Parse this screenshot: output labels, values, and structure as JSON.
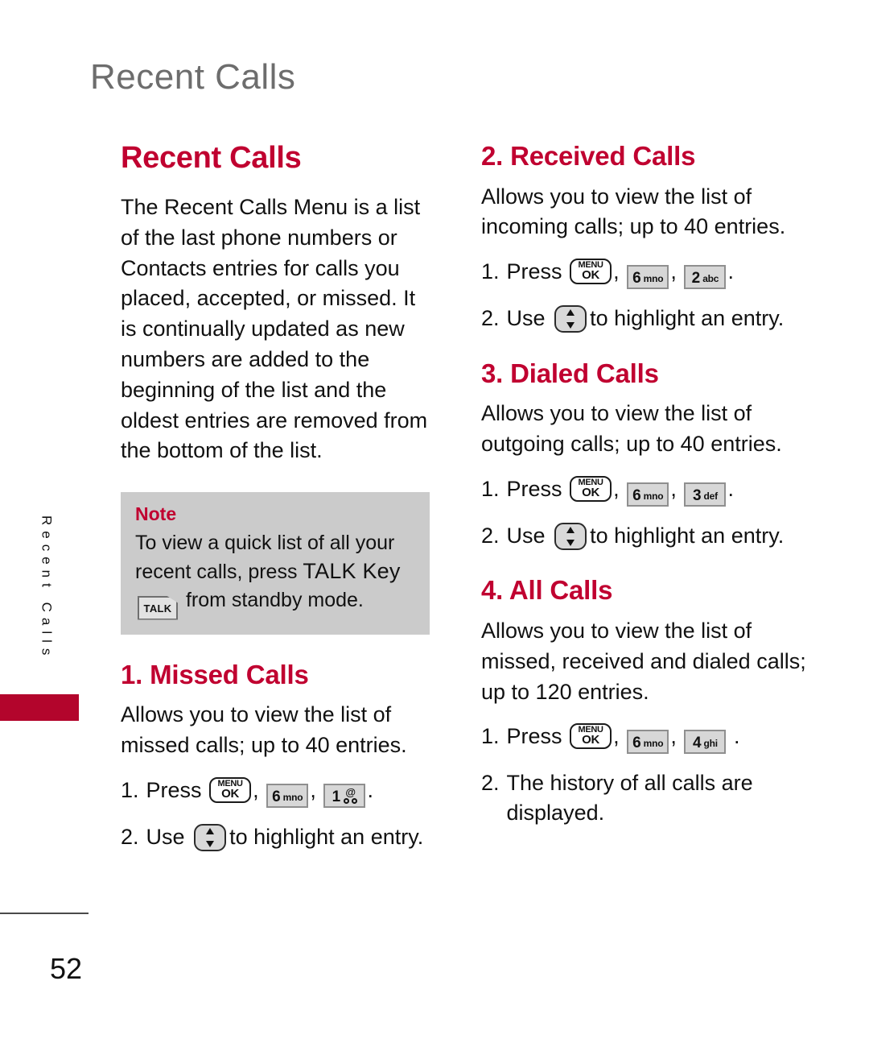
{
  "page": {
    "running_header": "Recent Calls",
    "number": "52"
  },
  "side_tab": {
    "label": "Recent Calls",
    "color": "#b3052c"
  },
  "colors": {
    "accent_red": "#c00030",
    "tab_red": "#b3052c",
    "header_gray": "#6d6d6d",
    "note_background": "#cbcbcb",
    "body_text": "#111111"
  },
  "keys": {
    "menu_ok": {
      "top": "MENU",
      "bottom": "OK",
      "name": "menu-ok-key"
    },
    "six": {
      "digit": "6",
      "letters": "mno",
      "name": "six-mno-key"
    },
    "one": {
      "digit": "1",
      "letters": "@",
      "name": "one-voicemail-key"
    },
    "two": {
      "digit": "2",
      "letters": "abc",
      "name": "two-abc-key"
    },
    "three": {
      "digit": "3",
      "letters": "def",
      "name": "three-def-key"
    },
    "four": {
      "digit": "4",
      "letters": "ghi",
      "name": "four-ghi-key"
    },
    "nav": {
      "name": "navigation-up-down-key"
    },
    "talk": {
      "label": "TALK",
      "name": "talk-key"
    }
  },
  "left_column": {
    "title": "Recent Calls",
    "intro": "The Recent Calls Menu is a list of the last phone numbers or Contacts entries for calls you placed, accepted, or missed. It is continually updated as new numbers are added to the beginning of the list and the oldest entries are removed from the bottom of the list.",
    "note": {
      "title": "Note",
      "text_before": "To view a quick list of all your recent calls, press ",
      "text_emphasis": "TALK Key",
      "text_after": " from standby mode."
    },
    "section_missed": {
      "title": "1. Missed Calls",
      "description": "Allows you to view the list of missed calls; up to 40 entries.",
      "step1_num": "1.",
      "step1_before": "Press ",
      "step1_comma1": ",",
      "step1_comma2": ",",
      "step1_period": ".",
      "step2_num": "2.",
      "step2_before": "Use ",
      "step2_after": "to highlight an entry."
    }
  },
  "right_column": {
    "section_received": {
      "title": "2. Received Calls",
      "description": "Allows you to view the list of incoming calls; up to 40 entries.",
      "step1_num": "1.",
      "step1_before": "Press ",
      "step1_comma1": ",",
      "step1_comma2": ",",
      "step1_period": ".",
      "step2_num": "2.",
      "step2_before": "Use ",
      "step2_after": "to highlight an entry."
    },
    "section_dialed": {
      "title": "3. Dialed Calls",
      "description": "Allows you to view the list of outgoing calls; up to 40 entries.",
      "step1_num": "1.",
      "step1_before": "Press ",
      "step1_comma1": ",",
      "step1_comma2": ",",
      "step1_period": ".",
      "step2_num": "2.",
      "step2_before": "Use ",
      "step2_after": "to highlight an entry."
    },
    "section_all": {
      "title": "4. All Calls",
      "description": "Allows you to view the list of missed, received and dialed calls; up to 120 entries.",
      "step1_num": "1.",
      "step1_before": "Press ",
      "step1_comma1": ",",
      "step1_comma2": ",",
      "step1_period": ".",
      "step2_num": "2.",
      "step2_text": "The history of all calls are displayed."
    }
  }
}
